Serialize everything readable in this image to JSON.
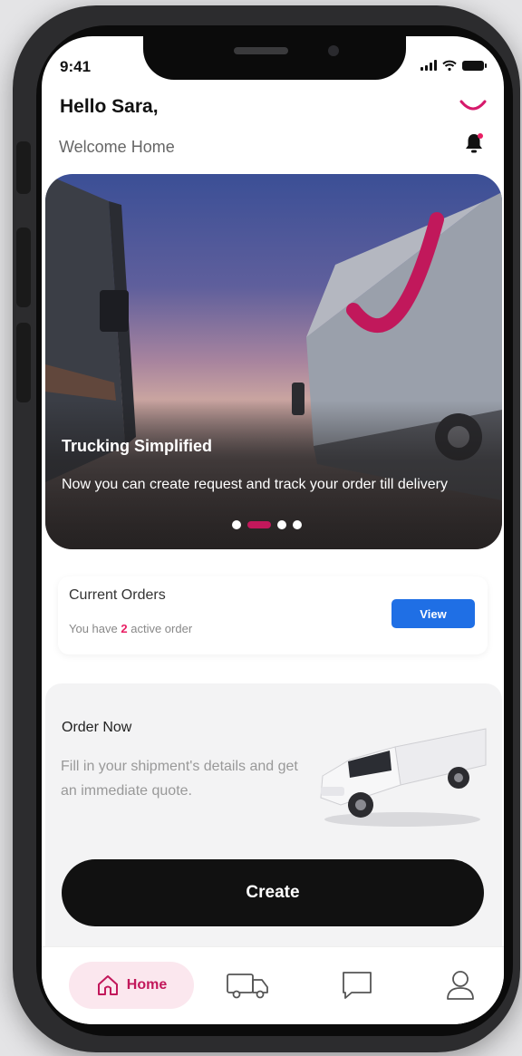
{
  "status_bar": {
    "time": "9:41"
  },
  "header": {
    "greeting": "Hello Sara,",
    "subtitle": "Welcome Home"
  },
  "icons": {
    "brand": "brand-smile-icon",
    "notification": "bell-icon",
    "nav_home": "home-icon",
    "nav_shipments": "truck-icon",
    "nav_messages": "chat-icon",
    "nav_profile": "user-icon"
  },
  "hero": {
    "title": "Trucking Simplified",
    "text": "Now you can create request and track your order till delivery",
    "slides_total": 4,
    "active_slide": 2
  },
  "current_orders": {
    "title": "Current Orders",
    "text_prefix": "You have",
    "count": "2",
    "text_suffix": "active order",
    "button": "View"
  },
  "order_now": {
    "title": "Order Now",
    "text": "Fill in your shipment's details and get an immediate quote.",
    "button": "Create"
  },
  "nav": {
    "home_label": "Home"
  },
  "colors": {
    "accent": "#c2185b",
    "link_blue": "#1f6fe5",
    "primary_button": "#111111",
    "home_pill": "#fbe7ee"
  }
}
